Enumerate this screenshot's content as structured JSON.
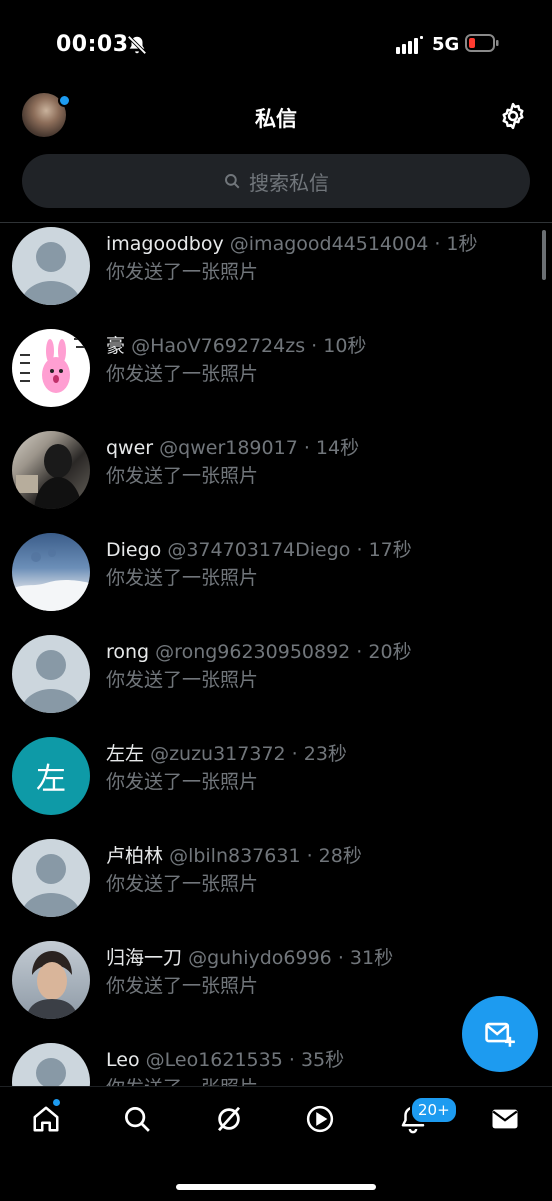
{
  "status_bar": {
    "time": "00:03",
    "network": "5G"
  },
  "header": {
    "title": "私信"
  },
  "search": {
    "placeholder": "搜索私信"
  },
  "conversations": [
    {
      "name": "imagoodboy",
      "handle": "@imagood44514004",
      "time": "1秒",
      "preview": "你发送了一张照片",
      "avatar": "default"
    },
    {
      "name": "豪",
      "handle": "@HaoV7692724zs",
      "time": "10秒",
      "preview": "你发送了一张照片",
      "avatar": "sticker"
    },
    {
      "name": "qwer",
      "handle": "@qwer189017",
      "time": "14秒",
      "preview": "你发送了一张照片",
      "avatar": "photo"
    },
    {
      "name": "Diego",
      "handle": "@374703174Diego",
      "time": "17秒",
      "preview": "你发送了一张照片",
      "avatar": "sky"
    },
    {
      "name": "rong",
      "handle": "@rong96230950892",
      "time": "20秒",
      "preview": "你发送了一张照片",
      "avatar": "default"
    },
    {
      "name": "左左",
      "handle": "@zuzu317372",
      "time": "23秒",
      "preview": "你发送了一张照片",
      "avatar": "letter",
      "letter": "左"
    },
    {
      "name": "卢柏林",
      "handle": "@lbiln837631",
      "time": "28秒",
      "preview": "你发送了一张照片",
      "avatar": "default"
    },
    {
      "name": "归海一刀",
      "handle": "@guhiydo6996",
      "time": "31秒",
      "preview": "你发送了一张照片",
      "avatar": "portrait"
    },
    {
      "name": "Leo",
      "handle": "@Leo1621535",
      "time": "35秒",
      "preview": "你发送了一张照片",
      "avatar": "default"
    }
  ],
  "tabs": [
    {
      "name": "home",
      "icon": "home-icon",
      "active": true
    },
    {
      "name": "search",
      "icon": "search-icon"
    },
    {
      "name": "communities",
      "icon": "grok-icon"
    },
    {
      "name": "video",
      "icon": "play-icon"
    },
    {
      "name": "notifications",
      "icon": "bell-icon",
      "badge": "20+"
    },
    {
      "name": "messages",
      "icon": "mail-icon"
    }
  ],
  "colors": {
    "accent": "#1d9bf0",
    "background": "#000000",
    "muted": "#71767b"
  }
}
